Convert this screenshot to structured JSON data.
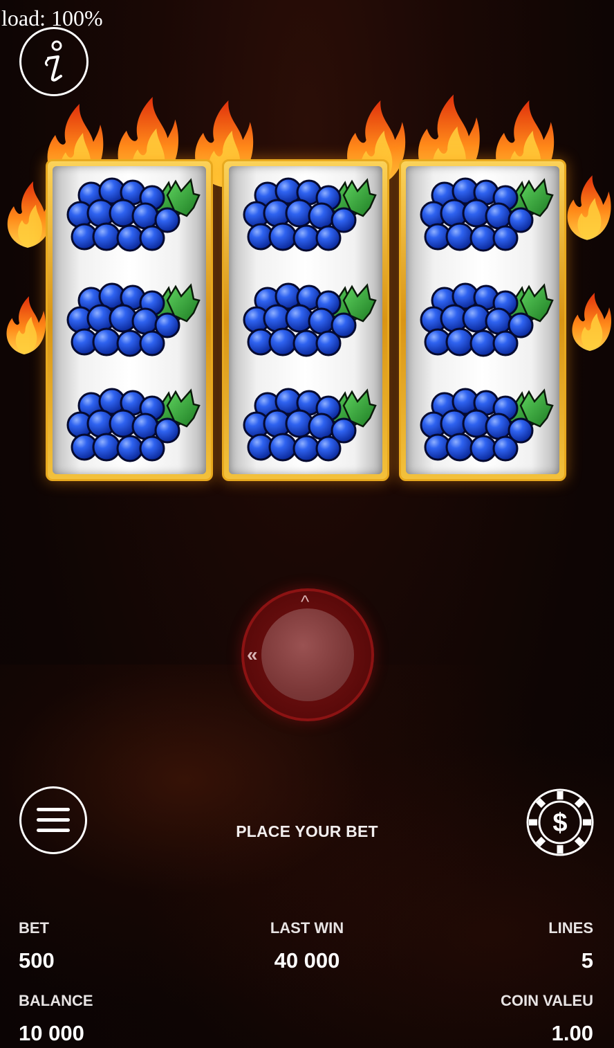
{
  "debug": {
    "load_text": "load: 100%"
  },
  "icons": {
    "info": "info-icon",
    "menu": "hamburger-menu-icon",
    "coin": "dollar-coin-icon",
    "spin": "spin-button",
    "symbol": "grapes-icon"
  },
  "reels": [
    {
      "symbols": [
        "grapes",
        "grapes",
        "grapes"
      ]
    },
    {
      "symbols": [
        "grapes",
        "grapes",
        "grapes"
      ]
    },
    {
      "symbols": [
        "grapes",
        "grapes",
        "grapes"
      ]
    }
  ],
  "spin": {
    "up_glyph": "^",
    "left_glyph": "«"
  },
  "status": {
    "message": "PLACE YOUR BET"
  },
  "stats": {
    "bet": {
      "label": "BET",
      "value": "500"
    },
    "last_win": {
      "label": "LAST WIN",
      "value": "40 000"
    },
    "lines": {
      "label": "LINES",
      "value": "5"
    },
    "balance": {
      "label": "BALANCE",
      "value": "10 000"
    },
    "coin_value": {
      "label": "COIN VALEU",
      "value": "1.00"
    }
  },
  "colors": {
    "background": "#0c0505",
    "frame_gold": "#e8a91f",
    "spin_red": "#8c1313",
    "grape_blue": "#1f4fe0",
    "leaf_green": "#2c9a2c",
    "text": "#ffffff"
  }
}
